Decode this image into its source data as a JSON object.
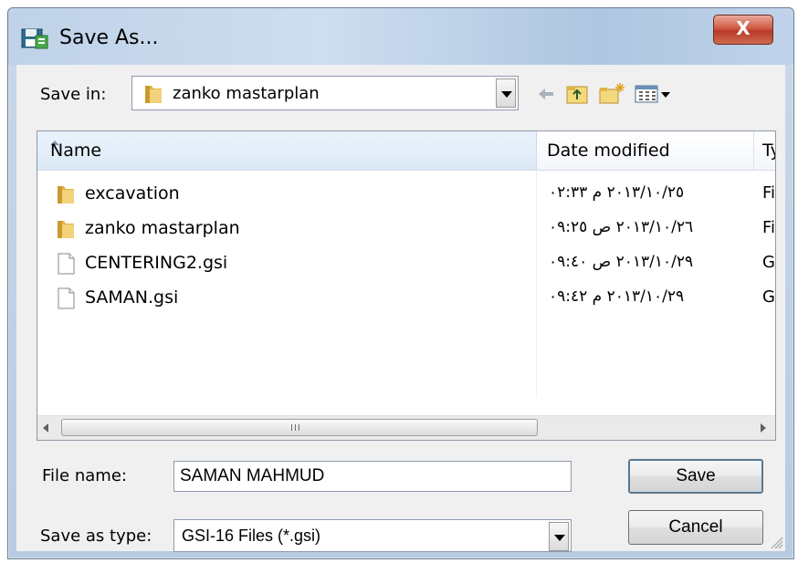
{
  "window": {
    "title": "Save As...",
    "close_label": "X"
  },
  "toolbar": {
    "save_in_label": "Save in:",
    "save_in_value": "zanko mastarplan"
  },
  "file_list": {
    "columns": {
      "name": "Name",
      "date_modified": "Date modified",
      "type": "Ty"
    },
    "rows": [
      {
        "name": "excavation",
        "date": "٢٠١٣/١٠/٢٥ م ٠٢:٣٣",
        "type": "Fi",
        "icon": "folder-icon"
      },
      {
        "name": "zanko mastarplan",
        "date": "٢٠١٣/١٠/٢٦ ص ٠٩:٢٥",
        "type": "Fi",
        "icon": "folder-icon"
      },
      {
        "name": "CENTERING2.gsi",
        "date": "٢٠١٣/١٠/٢٩ ص ٠٩:٤٠",
        "type": "G!",
        "icon": "file-icon"
      },
      {
        "name": "SAMAN.gsi",
        "date": "٢٠١٣/١٠/٢٩ م ٠٩:٤٢",
        "type": "G!",
        "icon": "file-icon"
      }
    ],
    "scroll_grip": "III"
  },
  "form": {
    "file_name_label": "File name:",
    "file_name_value": "SAMAN MAHMUD",
    "save_as_type_label": "Save as type:",
    "save_as_type_value": "GSI-16 Files (*.gsi)"
  },
  "buttons": {
    "save": "Save",
    "cancel": "Cancel"
  }
}
